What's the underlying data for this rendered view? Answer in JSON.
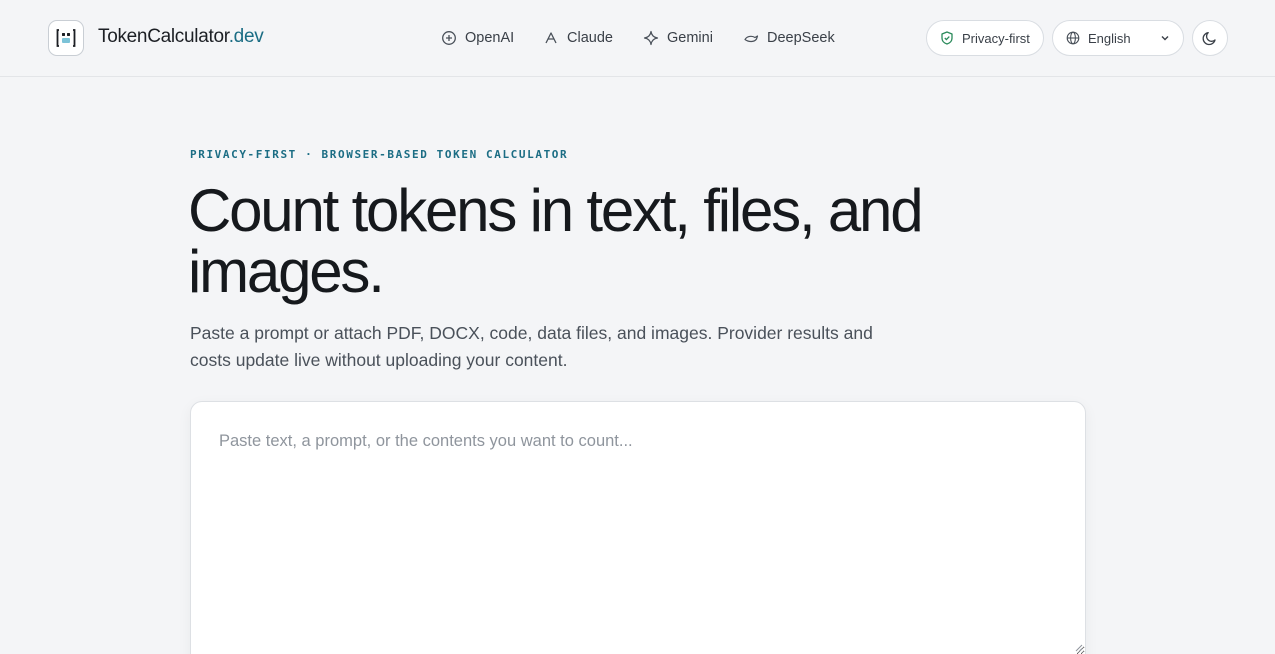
{
  "brand": {
    "name": "TokenCalculator",
    "suffix": ".dev",
    "accent_color": "#1b6d84"
  },
  "nav": {
    "items": [
      {
        "label": "OpenAI",
        "icon": "openai-icon"
      },
      {
        "label": "Claude",
        "icon": "claude-icon"
      },
      {
        "label": "Gemini",
        "icon": "gemini-icon"
      },
      {
        "label": "DeepSeek",
        "icon": "deepseek-icon"
      }
    ]
  },
  "header_controls": {
    "privacy_label": "Privacy-first",
    "language_selected": "English",
    "theme_toggle_icon": "moon-icon"
  },
  "hero": {
    "eyebrow": "PRIVACY-FIRST · BROWSER-BASED TOKEN CALCULATOR",
    "title": "Count tokens in text, files, and images.",
    "subtitle": "Paste a prompt or attach PDF, DOCX, code, data files, and images. Provider results and costs update live without uploading your content."
  },
  "input": {
    "placeholder": "Paste text, a prompt, or the contents you want to count...",
    "value": ""
  }
}
